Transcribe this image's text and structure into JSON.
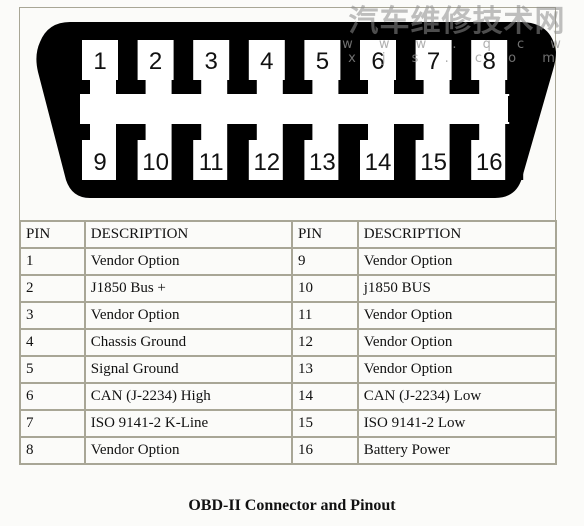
{
  "connector": {
    "top_row_pins": [
      "1",
      "2",
      "3",
      "4",
      "5",
      "6",
      "7",
      "8"
    ],
    "bottom_row_pins": [
      "9",
      "10",
      "11",
      "12",
      "13",
      "14",
      "15",
      "16"
    ],
    "colors": {
      "body": "#000000",
      "pin_slot": "#ffffff",
      "frame": "#a8a696"
    }
  },
  "watermark": {
    "title": "汽车维修技术网",
    "url": "w w w . q c w x j s . c o m"
  },
  "table": {
    "headers": [
      "PIN",
      "DESCRIPTION",
      "PIN",
      "DESCRIPTION"
    ],
    "rows": [
      [
        "1",
        "Vendor Option",
        "9",
        "Vendor Option"
      ],
      [
        "2",
        "J1850 Bus +",
        "10",
        "j1850 BUS"
      ],
      [
        "3",
        "Vendor Option",
        "11",
        "Vendor Option"
      ],
      [
        "4",
        "Chassis Ground",
        "12",
        "Vendor Option"
      ],
      [
        "5",
        "Signal Ground",
        "13",
        "Vendor Option"
      ],
      [
        "6",
        "CAN (J-2234) High",
        "14",
        "CAN (J-2234) Low"
      ],
      [
        "7",
        "ISO 9141-2 K-Line",
        "15",
        "ISO 9141-2 Low"
      ],
      [
        "8",
        "Vendor Option",
        "16",
        "Battery Power"
      ]
    ]
  },
  "caption": "OBD-II Connector and Pinout"
}
